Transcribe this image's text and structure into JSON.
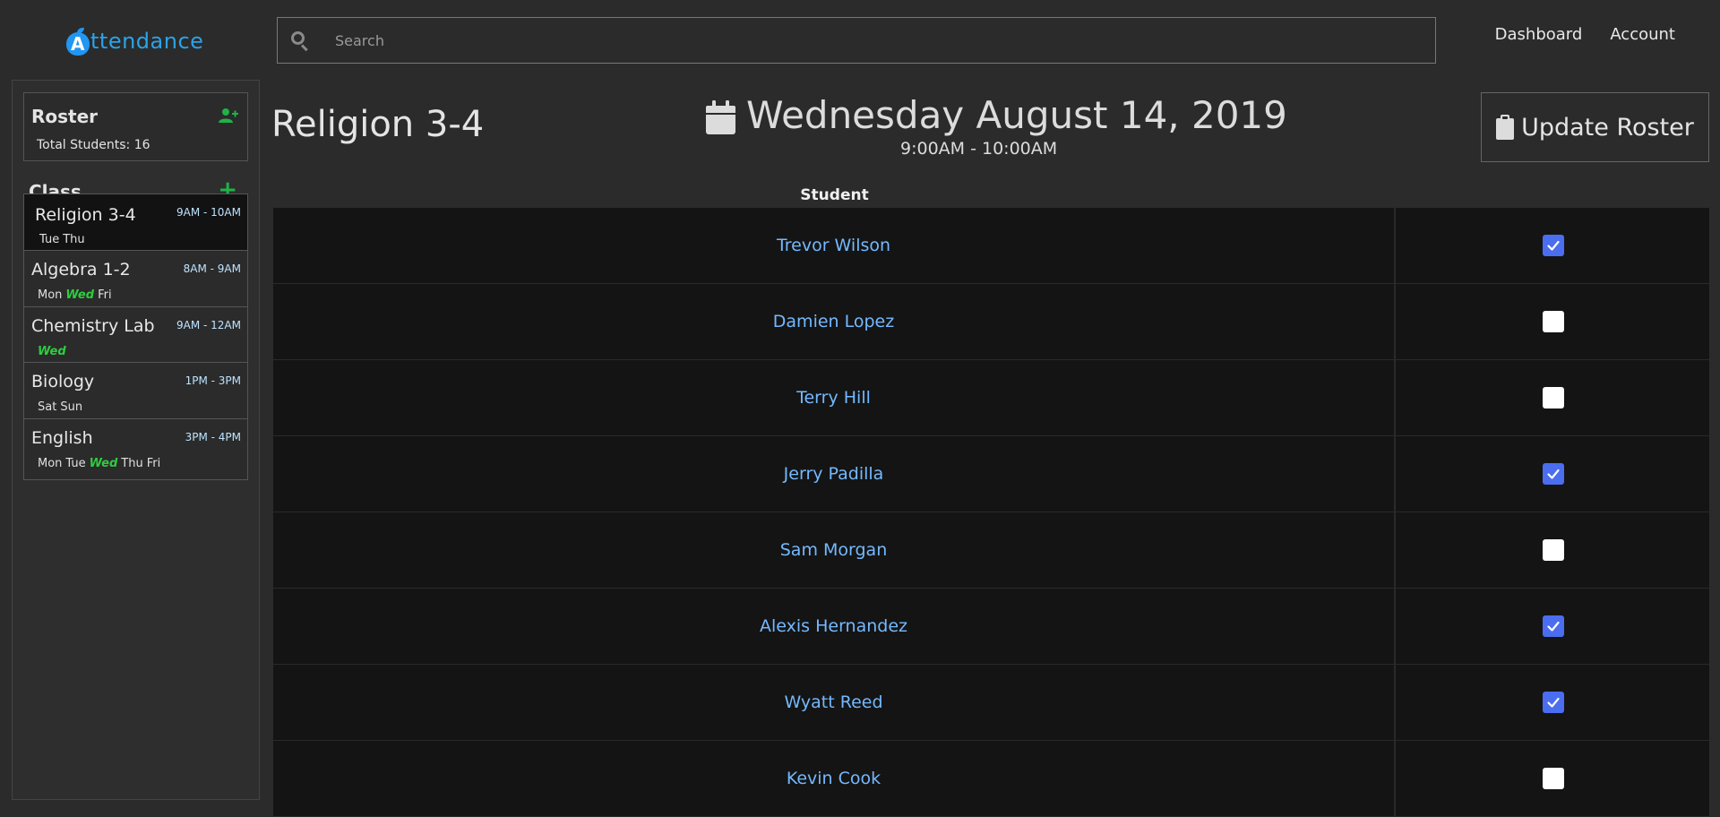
{
  "header": {
    "logo_letter": "A",
    "logo_text": "ttendance",
    "search_placeholder": "Search",
    "nav": [
      "Dashboard",
      "Account"
    ]
  },
  "sidebar": {
    "roster": {
      "title": "Roster",
      "total": "Total Students: 16"
    },
    "class_header": "Class",
    "classes": [
      {
        "name": "Religion 3-4",
        "time": "9AM - 10AM",
        "days": [
          "Tue",
          "Thu"
        ],
        "active": true
      },
      {
        "name": "Algebra 1-2",
        "time": "8AM - 9AM",
        "days": [
          "Mon",
          "Wed",
          "Fri"
        ]
      },
      {
        "name": "Chemistry Lab",
        "time": "9AM - 12AM",
        "days": [
          "Wed"
        ]
      },
      {
        "name": "Biology",
        "time": "1PM - 3PM",
        "days": [
          "Sat",
          "Sun"
        ]
      },
      {
        "name": "English",
        "time": "3PM - 4PM",
        "days": [
          "Mon",
          "Tue",
          "Wed",
          "Thu",
          "Fri"
        ]
      }
    ],
    "highlight_day": "Wed"
  },
  "main": {
    "class_title": "Religion 3-4",
    "date": "Wednesday August 14, 2019",
    "time_range": "9:00AM - 10:00AM",
    "update_roster_label": "Update Roster",
    "table": {
      "student_header": "Student",
      "rows": [
        {
          "name": "Trevor Wilson",
          "present": true
        },
        {
          "name": "Damien Lopez",
          "present": false
        },
        {
          "name": "Terry Hill",
          "present": false
        },
        {
          "name": "Jerry Padilla",
          "present": true
        },
        {
          "name": "Sam Morgan",
          "present": false
        },
        {
          "name": "Alexis Hernandez",
          "present": true
        },
        {
          "name": "Wyatt Reed",
          "present": true
        },
        {
          "name": "Kevin Cook",
          "present": false
        }
      ]
    }
  },
  "colors": {
    "accent_blue": "#2aa3e8",
    "link_blue": "#74b9ff",
    "checkbox_blue": "#4b6df0",
    "today_green": "#2ecc40",
    "add_green": "#1fb345"
  },
  "icons": [
    "apple-logo-icon",
    "search-icon",
    "add-user-icon",
    "plus-icon",
    "calendar-icon",
    "clipboard-icon",
    "check-icon"
  ]
}
